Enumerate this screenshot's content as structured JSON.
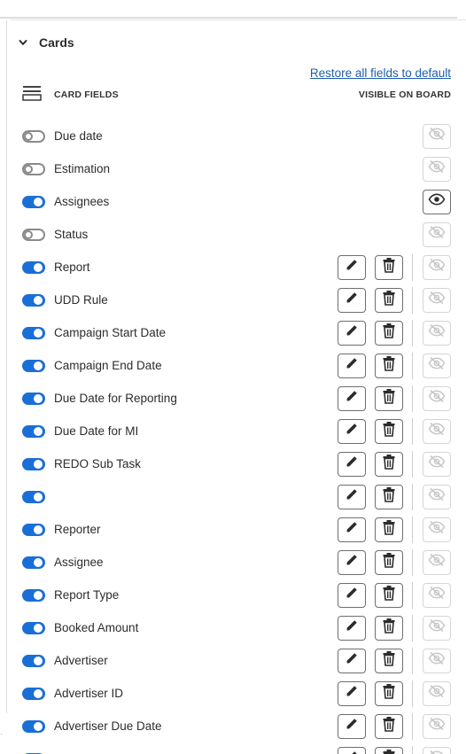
{
  "section": {
    "title": "Cards",
    "icon": "chevron-down-icon"
  },
  "restore_link": "Restore all fields to default",
  "fields_header": {
    "label": "CARD FIELDS",
    "visible_label": "VISIBLE ON BOARD",
    "icon": "card-layout-icon"
  },
  "colors": {
    "toggle_on": "#1a6fd6",
    "link": "#1f5ea8"
  },
  "rows": [
    {
      "label": "Due date",
      "enabled": false,
      "editable": false,
      "visible": false
    },
    {
      "label": "Estimation",
      "enabled": false,
      "editable": false,
      "visible": false
    },
    {
      "label": "Assignees",
      "enabled": true,
      "editable": false,
      "visible": true
    },
    {
      "label": "Status",
      "enabled": false,
      "editable": false,
      "visible": false
    },
    {
      "label": "Report",
      "enabled": true,
      "editable": true,
      "visible": false
    },
    {
      "label": "UDD Rule",
      "enabled": true,
      "editable": true,
      "visible": false
    },
    {
      "label": "Campaign Start Date",
      "enabled": true,
      "editable": true,
      "visible": false
    },
    {
      "label": "Campaign End Date",
      "enabled": true,
      "editable": true,
      "visible": false
    },
    {
      "label": "Due Date for Reporting",
      "enabled": true,
      "editable": true,
      "visible": false
    },
    {
      "label": "Due Date for MI",
      "enabled": true,
      "editable": true,
      "visible": false
    },
    {
      "label": "REDO Sub Task",
      "enabled": true,
      "editable": true,
      "visible": false
    },
    {
      "label": "",
      "enabled": true,
      "editable": true,
      "visible": false
    },
    {
      "label": "Reporter",
      "enabled": true,
      "editable": true,
      "visible": false
    },
    {
      "label": "Assignee",
      "enabled": true,
      "editable": true,
      "visible": false
    },
    {
      "label": "Report Type",
      "enabled": true,
      "editable": true,
      "visible": false
    },
    {
      "label": "Booked Amount",
      "enabled": true,
      "editable": true,
      "visible": false
    },
    {
      "label": "Advertiser",
      "enabled": true,
      "editable": true,
      "visible": false
    },
    {
      "label": "Advertiser ID",
      "enabled": true,
      "editable": true,
      "visible": false
    },
    {
      "label": "Advertiser Due Date",
      "enabled": true,
      "editable": true,
      "visible": false
    },
    {
      "label": "",
      "enabled": true,
      "editable": true,
      "visible": false
    }
  ]
}
